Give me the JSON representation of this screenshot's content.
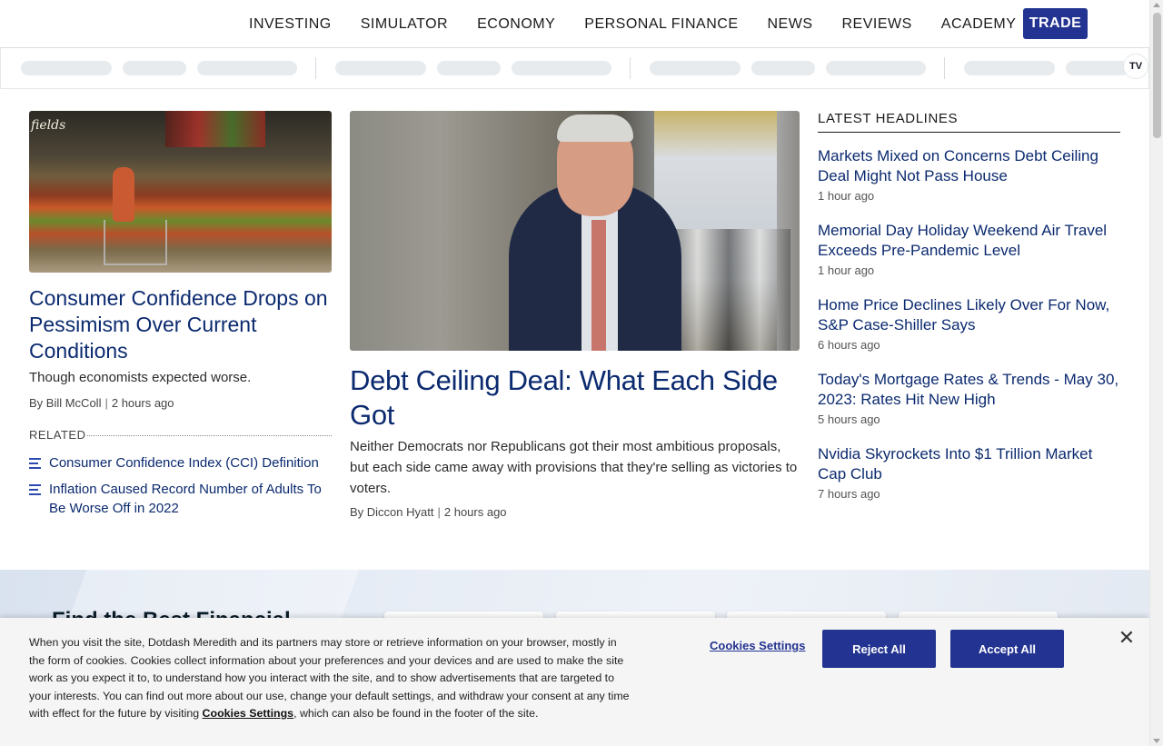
{
  "nav": {
    "items": [
      "INVESTING",
      "SIMULATOR",
      "ECONOMY",
      "PERSONAL FINANCE",
      "NEWS",
      "REVIEWS",
      "ACADEMY"
    ],
    "trade_label": "TRADE"
  },
  "ticker": {
    "logo": "TV"
  },
  "left_article": {
    "headline": "Consumer Confidence Drops on Pessimism Over Current Conditions",
    "dek": "Though economists expected worse.",
    "author": "By Bill McColl",
    "time": "2 hours ago",
    "image_sign": "fields",
    "related_label": "RELATED",
    "related": [
      "Consumer Confidence Index (CCI) Definition",
      "Inflation Caused Record Number of Adults To Be Worse Off in 2022"
    ]
  },
  "center_article": {
    "headline": "Debt Ceiling Deal: What Each Side Got",
    "dek": "Neither Democrats nor Republicans got their most ambitious proposals, but each side came away with provisions that they're selling as victories to voters.",
    "author": "By Diccon Hyatt",
    "time": "2 hours ago"
  },
  "latest": {
    "title": "LATEST HEADLINES",
    "items": [
      {
        "title": "Markets Mixed on Concerns Debt Ceiling Deal Might Not Pass House",
        "time": "1 hour ago"
      },
      {
        "title": "Memorial Day Holiday Weekend Air Travel Exceeds Pre-Pandemic Level",
        "time": "1 hour ago"
      },
      {
        "title": "Home Price Declines Likely Over For Now, S&P Case-Shiller Says",
        "time": "6 hours ago"
      },
      {
        "title": "Today's Mortgage Rates & Trends - May 30, 2023: Rates Hit New High",
        "time": "5 hours ago"
      },
      {
        "title": "Nvidia Skyrockets Into $1 Trillion Market Cap Club",
        "time": "7 hours ago"
      }
    ]
  },
  "promo": {
    "title": "Find the Best Financial"
  },
  "cookie": {
    "text_before": "When you visit the site, Dotdash Meredith and its partners may store or retrieve information on your browser, mostly in the form of cookies. Cookies collect information about your preferences and your devices and are used to make the site work as you expect it to, to understand how you interact with the site, and to show advertisements that are targeted to your interests. You can find out more about our use, change your default settings, and withdraw your consent at any time with effect for the future by visiting ",
    "text_link": "Cookies Settings",
    "text_after": ", which can also be found in the footer of the site.",
    "settings_label": "Cookies Settings",
    "reject_label": "Reject All",
    "accept_label": "Accept All",
    "close_symbol": "✕"
  },
  "colors": {
    "brand": "#233391",
    "headline": "#0b2a6f"
  }
}
